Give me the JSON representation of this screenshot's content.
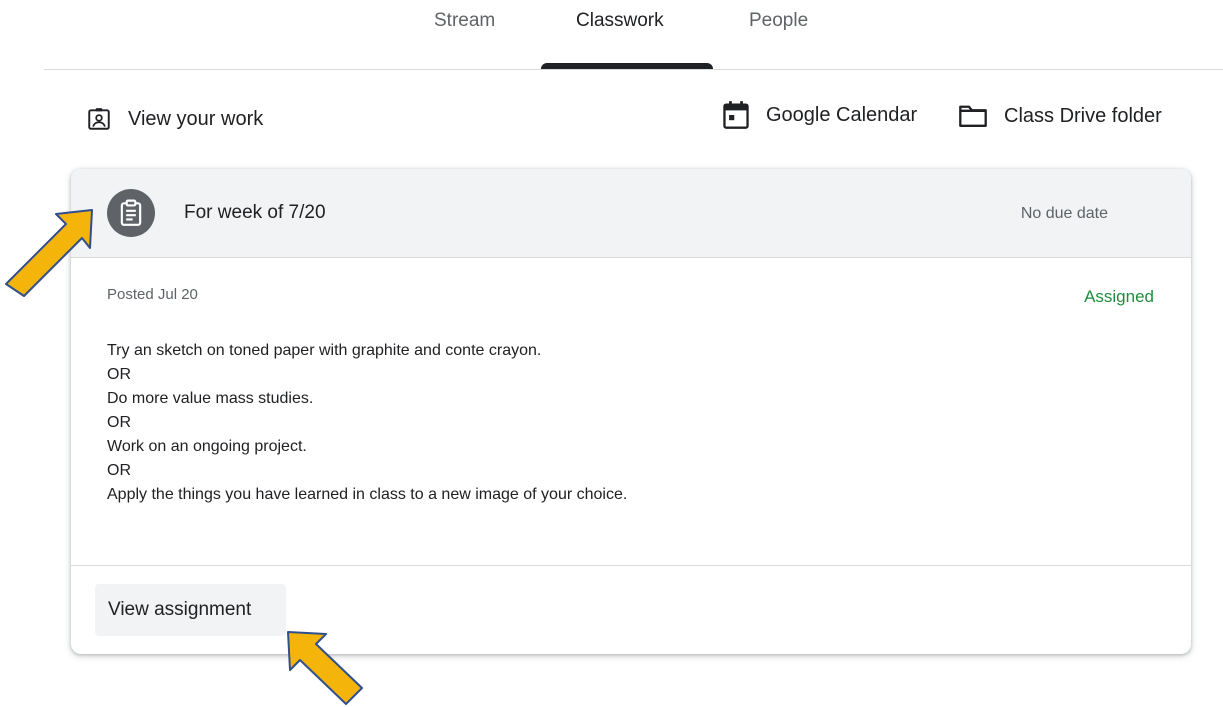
{
  "nav": {
    "tabs": [
      {
        "label": "Stream",
        "active": false
      },
      {
        "label": "Classwork",
        "active": true
      },
      {
        "label": "People",
        "active": false
      }
    ]
  },
  "toolbar": {
    "view_work_label": "View your work",
    "calendar_label": "Google Calendar",
    "drive_label": "Class Drive folder"
  },
  "assignment": {
    "title": "For week of 7/20",
    "due": "No due date",
    "posted": "Posted Jul 20",
    "status": "Assigned",
    "description_lines": [
      "Try an sketch on toned paper with graphite and conte crayon.",
      "OR",
      "Do more value mass studies.",
      "OR",
      "Work on an ongoing project.",
      "OR",
      "Apply the things you have learned in class to a new image of your choice."
    ],
    "view_button_label": "View assignment"
  },
  "colors": {
    "accent_text": "#202124",
    "secondary_text": "#5f6368",
    "status_green": "#1e8e3e",
    "header_bg": "#f1f3f4",
    "annotation_arrow": "#f5b40a",
    "annotation_outline": "#2f4f8f"
  },
  "icons": {
    "view_work": "assignment-ind-icon",
    "calendar": "calendar-icon",
    "drive": "folder-icon",
    "assignment": "assignment-icon",
    "annotation": "arrow-pointer-icon"
  }
}
